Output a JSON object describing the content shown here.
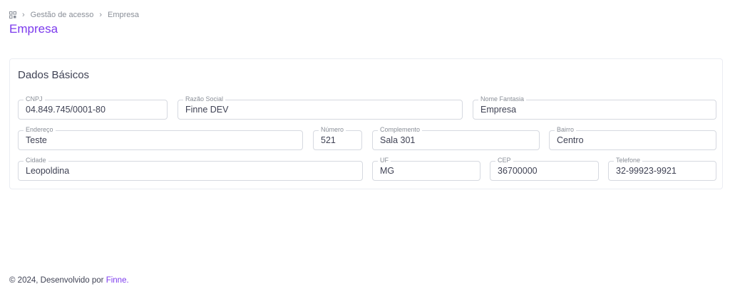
{
  "breadcrumb": {
    "items": [
      "Gestão de acesso",
      "Empresa"
    ],
    "separator": "›"
  },
  "page": {
    "title": "Empresa"
  },
  "card": {
    "title": "Dados Básicos",
    "fields": {
      "cnpj": {
        "label": "CNPJ",
        "value": "04.849.745/0001-80"
      },
      "razao_social": {
        "label": "Razão Social",
        "value": "Finne DEV"
      },
      "nome_fantasia": {
        "label": "Nome Fantasia",
        "value": "Empresa"
      },
      "endereco": {
        "label": "Endereço",
        "value": "Teste"
      },
      "numero": {
        "label": "Número",
        "value": "521"
      },
      "complemento": {
        "label": "Complemento",
        "value": "Sala 301"
      },
      "bairro": {
        "label": "Bairro",
        "value": "Centro"
      },
      "cidade": {
        "label": "Cidade",
        "value": "Leopoldina"
      },
      "uf": {
        "label": "UF",
        "value": "MG"
      },
      "cep": {
        "label": "CEP",
        "value": "36700000"
      },
      "telefone": {
        "label": "Telefone",
        "value": "32-99923-9921"
      }
    }
  },
  "footer": {
    "text": "© 2024, Desenvolvido por",
    "link": "Finne."
  },
  "colors": {
    "accent": "#7c3aed",
    "border": "#d6d9e0",
    "muted_text": "#8a8f98"
  }
}
